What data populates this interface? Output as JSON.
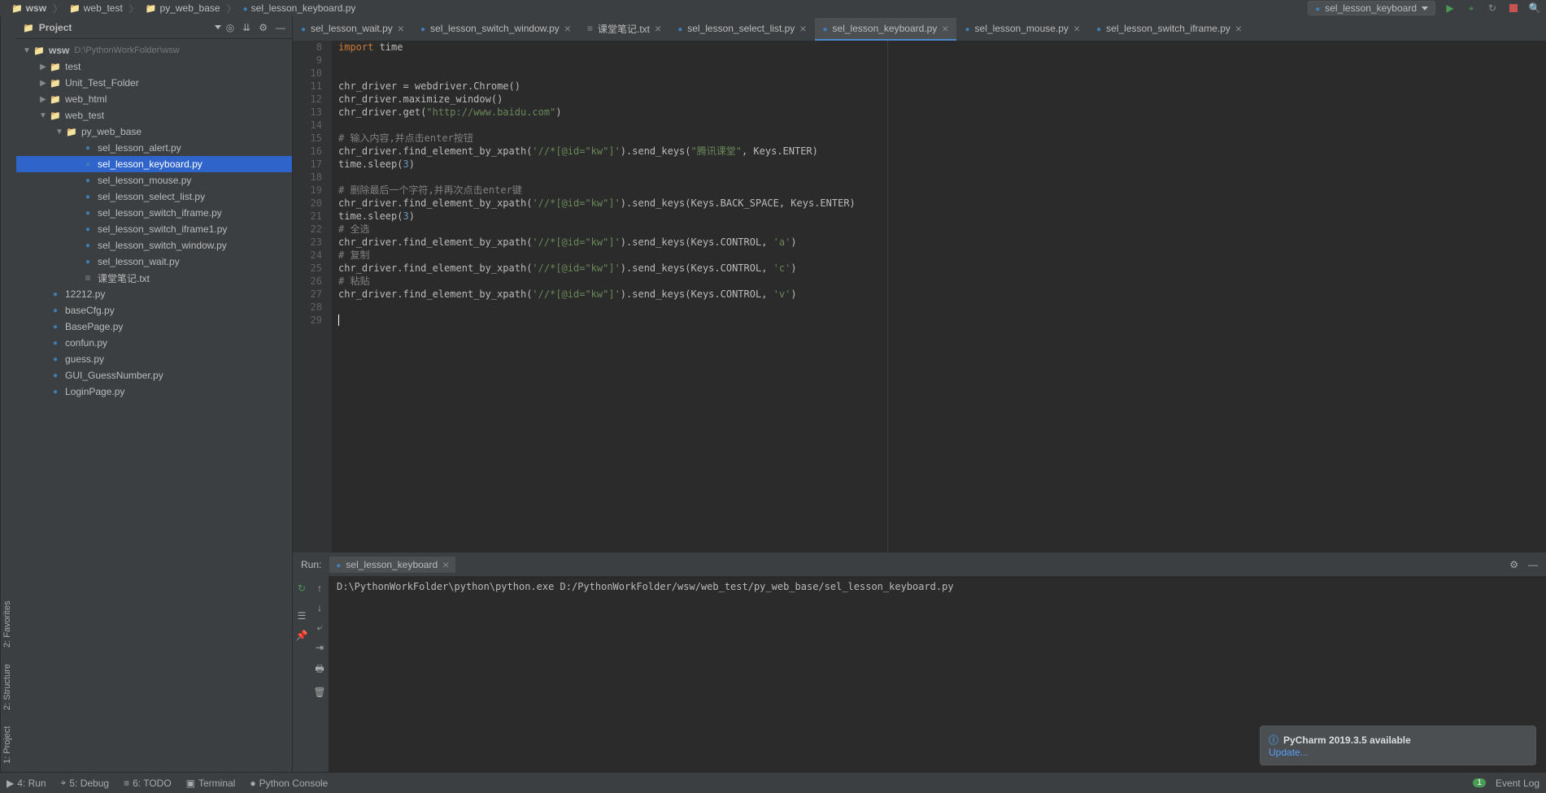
{
  "breadcrumb": [
    "wsw",
    "web_test",
    "py_web_base",
    "sel_lesson_keyboard.py"
  ],
  "run_config": "sel_lesson_keyboard",
  "project_header": "Project",
  "project_root": {
    "name": "wsw",
    "path": "D:\\PythonWorkFolder\\wsw"
  },
  "tree": [
    {
      "name": "test",
      "type": "folder",
      "indent": 1,
      "arrow": "▶"
    },
    {
      "name": "Unit_Test_Folder",
      "type": "folder",
      "indent": 1,
      "arrow": "▶"
    },
    {
      "name": "web_html",
      "type": "folder",
      "indent": 1,
      "arrow": "▶"
    },
    {
      "name": "web_test",
      "type": "folder",
      "indent": 1,
      "arrow": "▼"
    },
    {
      "name": "py_web_base",
      "type": "folder",
      "indent": 2,
      "arrow": "▼"
    },
    {
      "name": "sel_lesson_alert.py",
      "type": "py",
      "indent": 3
    },
    {
      "name": "sel_lesson_keyboard.py",
      "type": "py",
      "indent": 3,
      "selected": true
    },
    {
      "name": "sel_lesson_mouse.py",
      "type": "py",
      "indent": 3
    },
    {
      "name": "sel_lesson_select_list.py",
      "type": "py",
      "indent": 3
    },
    {
      "name": "sel_lesson_switch_iframe.py",
      "type": "py",
      "indent": 3
    },
    {
      "name": "sel_lesson_switch_iframe1.py",
      "type": "py",
      "indent": 3
    },
    {
      "name": "sel_lesson_switch_window.py",
      "type": "py",
      "indent": 3
    },
    {
      "name": "sel_lesson_wait.py",
      "type": "py",
      "indent": 3
    },
    {
      "name": "课堂笔记.txt",
      "type": "txt",
      "indent": 3
    },
    {
      "name": "12212.py",
      "type": "py",
      "indent": 1
    },
    {
      "name": "baseCfg.py",
      "type": "py",
      "indent": 1
    },
    {
      "name": "BasePage.py",
      "type": "py",
      "indent": 1
    },
    {
      "name": "confun.py",
      "type": "py",
      "indent": 1
    },
    {
      "name": "guess.py",
      "type": "py",
      "indent": 1
    },
    {
      "name": "GUI_GuessNumber.py",
      "type": "py",
      "indent": 1
    },
    {
      "name": "LoginPage.py",
      "type": "py",
      "indent": 1
    }
  ],
  "tabs": [
    {
      "label": "sel_lesson_wait.py",
      "type": "py"
    },
    {
      "label": "sel_lesson_switch_window.py",
      "type": "py"
    },
    {
      "label": "课堂笔记.txt",
      "type": "txt"
    },
    {
      "label": "sel_lesson_select_list.py",
      "type": "py"
    },
    {
      "label": "sel_lesson_keyboard.py",
      "type": "py",
      "active": true
    },
    {
      "label": "sel_lesson_mouse.py",
      "type": "py"
    },
    {
      "label": "sel_lesson_switch_iframe.py",
      "type": "py"
    }
  ],
  "code_lines": [
    {
      "n": 8,
      "html": "<span class='kw'>import</span> time"
    },
    {
      "n": 9,
      "html": ""
    },
    {
      "n": 10,
      "html": ""
    },
    {
      "n": 11,
      "html": "chr_driver = webdriver.Chrome()"
    },
    {
      "n": 12,
      "html": "chr_driver.maximize_window()"
    },
    {
      "n": 13,
      "html": "chr_driver.get(<span class='str'>\"http://www.baidu.com\"</span>)"
    },
    {
      "n": 14,
      "html": ""
    },
    {
      "n": 15,
      "html": "<span class='cmt'># 输入内容,并点击enter按钮</span>"
    },
    {
      "n": 16,
      "html": "chr_driver.find_element_by_xpath(<span class='str'>'//*[@id=\"kw\"]'</span>).send_keys(<span class='str'>\"腾讯课堂\"</span>, Keys.ENTER)"
    },
    {
      "n": 17,
      "html": "time.sleep(<span class='num'>3</span>)"
    },
    {
      "n": 18,
      "html": ""
    },
    {
      "n": 19,
      "html": "<span class='cmt'># 删除最后一个字符,并再次点击enter键</span>"
    },
    {
      "n": 20,
      "html": "chr_driver.find_element_by_xpath(<span class='str'>'//*[@id=\"kw\"]'</span>).send_keys(Keys.BACK_SPACE, Keys.ENTER)"
    },
    {
      "n": 21,
      "html": "time.sleep(<span class='num'>3</span>)"
    },
    {
      "n": 22,
      "html": "<span class='cmt'># 全选</span>"
    },
    {
      "n": 23,
      "html": "chr_driver.find_element_by_xpath(<span class='str'>'//*[@id=\"kw\"]'</span>).send_keys(Keys.CONTROL, <span class='str'>'a'</span>)"
    },
    {
      "n": 24,
      "html": "<span class='cmt'># 复制</span>"
    },
    {
      "n": 25,
      "html": "chr_driver.find_element_by_xpath(<span class='str'>'//*[@id=\"kw\"]'</span>).send_keys(Keys.CONTROL, <span class='str'>'c'</span>)"
    },
    {
      "n": 26,
      "html": "<span class='cmt'># 粘贴</span>"
    },
    {
      "n": 27,
      "html": "chr_driver.find_element_by_xpath(<span class='str'>'//*[@id=\"kw\"]'</span>).send_keys(Keys.CONTROL, <span class='str'>'v'</span>)"
    },
    {
      "n": 28,
      "html": ""
    },
    {
      "n": 29,
      "html": "<span class='caret'></span>"
    }
  ],
  "run": {
    "label": "Run:",
    "tab": "sel_lesson_keyboard",
    "output": "D:\\PythonWorkFolder\\python\\python.exe D:/PythonWorkFolder/wsw/web_test/py_web_base/sel_lesson_keyboard.py"
  },
  "bottom_items": [
    "4: Run",
    "5: Debug",
    "6: TODO",
    "Terminal",
    "Python Console"
  ],
  "event_log": "Event Log",
  "notif": {
    "title": "PyCharm 2019.3.5 available",
    "link": "Update..."
  },
  "sidebar_strip": [
    "1: Project",
    "2: Structure",
    "2: Favorites"
  ]
}
